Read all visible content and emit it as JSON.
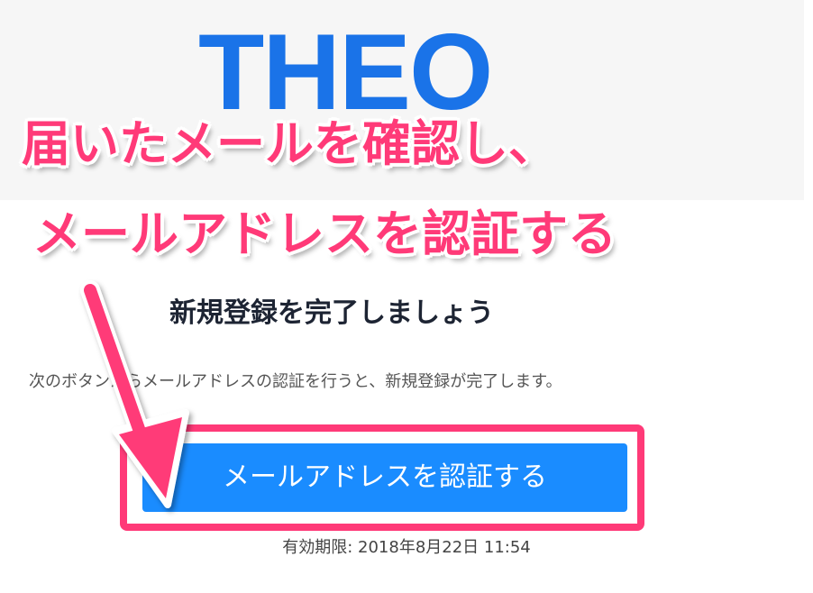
{
  "logo": {
    "text": "THEO"
  },
  "overlay": {
    "line1": "届いたメールを確認し、",
    "line2": "メールアドレスを認証する"
  },
  "main": {
    "title": "新規登録を完了しましょう",
    "description": "次のボタンからメールアドレスの認証を行うと、新規登録が完了します。",
    "button_label": "メールアドレスを認証する",
    "expiry_label": "有効期限: 2018年8月22日 11:54"
  },
  "colors": {
    "accent": "#ff3a78",
    "button": "#1a8cff",
    "logo": "#1a73e8"
  }
}
